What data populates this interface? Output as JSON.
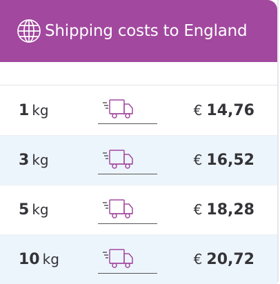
{
  "header": {
    "title": "Shipping costs to England",
    "icon": "globe-icon",
    "color": "#a2489f"
  },
  "rates": [
    {
      "weight": "1",
      "unit": "kg",
      "currency": "€",
      "price": "14,76",
      "icon": "delivery-truck-icon"
    },
    {
      "weight": "3",
      "unit": "kg",
      "currency": "€",
      "price": "16,52",
      "icon": "delivery-truck-icon"
    },
    {
      "weight": "5",
      "unit": "kg",
      "currency": "€",
      "price": "18,28",
      "icon": "delivery-truck-icon"
    },
    {
      "weight": "10",
      "unit": "kg",
      "currency": "€",
      "price": "20,72",
      "icon": "delivery-truck-icon"
    }
  ],
  "colors": {
    "accent": "#a2489f",
    "row_alt": "#edf5fc",
    "text": "#333338"
  }
}
